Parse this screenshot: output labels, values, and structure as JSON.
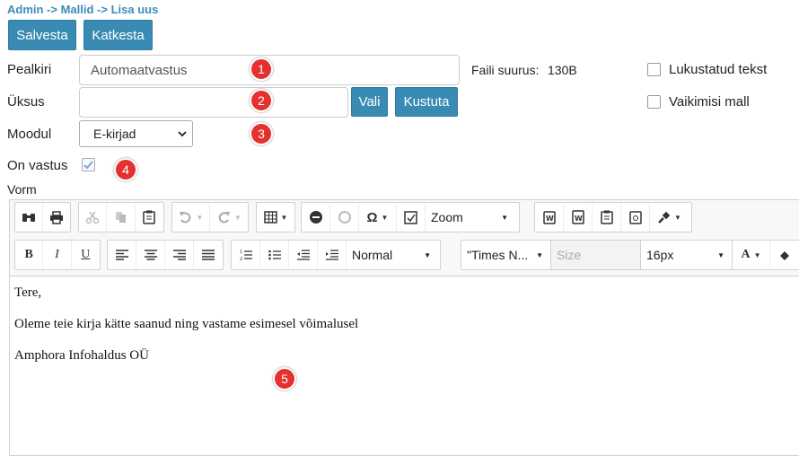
{
  "breadcrumb": "Admin -> Mallid -> Lisa uus",
  "buttons": {
    "save": "Salvesta",
    "cancel": "Katkesta",
    "choose": "Vali",
    "delete": "Kustuta"
  },
  "form": {
    "title_label": "Pealkiri",
    "title_value": "Automaatvastus",
    "unit_label": "Üksus",
    "unit_value": "",
    "module_label": "Moodul",
    "module_value": "E-kirjad",
    "is_reply_label": "On vastus",
    "is_reply_checked": true,
    "form_label": "Vorm",
    "file_size_label": "Faili suurus:",
    "file_size_value": "130B",
    "locked_text_label": "Lukustatud tekst",
    "default_template_label": "Vaikimisi mall"
  },
  "badges": [
    "1",
    "2",
    "3",
    "4",
    "5"
  ],
  "toolbar": {
    "zoom": "Zoom",
    "format": "Normal",
    "font": "\"Times N...",
    "size_placeholder": "Size",
    "font_size": "16px"
  },
  "editor": {
    "lines": [
      "Tere,",
      "Oleme teie kirja kätte saanud ning vastame esimesel võimalusel",
      "Amphora Infohaldus OÜ"
    ]
  },
  "colors": {
    "primary": "#3a8bb3",
    "badge": "#e53030",
    "breadcrumb": "#3b8cb8"
  }
}
